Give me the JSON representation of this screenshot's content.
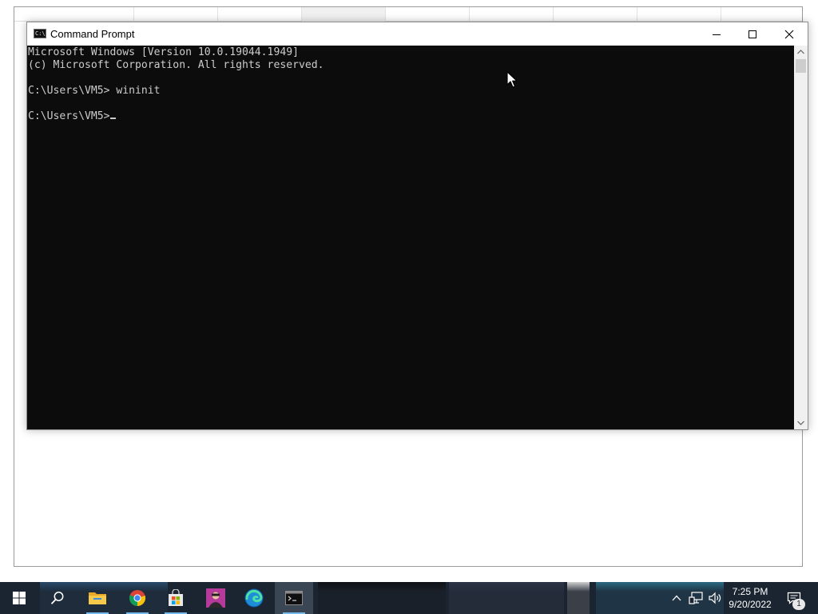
{
  "window": {
    "title": "Command Prompt",
    "icon": "cmd-icon",
    "icon_glyph": "C:\\"
  },
  "console": {
    "lines": [
      "Microsoft Windows [Version 10.0.19044.1949]",
      "(c) Microsoft Corporation. All rights reserved.",
      "C:\\Users\\VM5> wininit",
      "C:\\Users\\VM5>"
    ],
    "text_color": "#cccccc",
    "background": "#0c0c0c"
  },
  "taskbar": {
    "background": "#1b2531",
    "pinned": [
      {
        "name": "start",
        "icon": "windows-logo-icon"
      },
      {
        "name": "search",
        "icon": "search-icon"
      },
      {
        "name": "file-explorer",
        "icon": "folder-icon"
      },
      {
        "name": "chrome",
        "icon": "chrome-icon"
      },
      {
        "name": "microsoft-store",
        "icon": "store-icon"
      },
      {
        "name": "game-app",
        "icon": "game-app-icon"
      },
      {
        "name": "edge",
        "icon": "edge-icon"
      },
      {
        "name": "command-prompt",
        "icon": "cmd-icon"
      }
    ],
    "tray": {
      "time": "7:25 PM",
      "date": "9/20/2022",
      "notification_count": "1"
    }
  }
}
